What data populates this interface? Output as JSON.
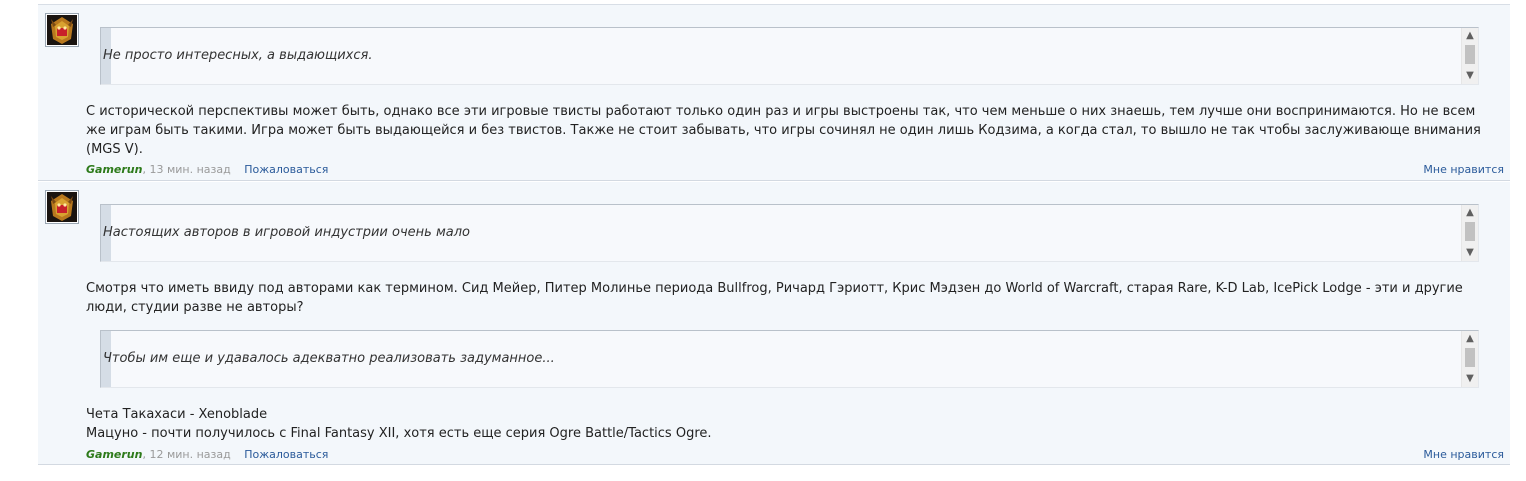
{
  "comments": [
    {
      "quotes": [
        "Не просто интересных, а выдающихся."
      ],
      "paragraphs": [
        "С исторической перспективы может быть, однако все эти игровые твисты работают только один раз и игры выстроены так, что чем меньше о них знаешь, тем лучше они воспринимаются. Но не всем же играм быть такими. Игра может быть выдающейся и без твистов. Также не стоит забывать, что игры сочинял не один лишь Кодзима, а когда стал, то вышло не так чтобы заслуживающе внимания (MGS V)."
      ],
      "author": "Gamerun",
      "time": ", 13 мин. назад",
      "report_label": "Пожаловаться",
      "like_label": "Мне нравится"
    },
    {
      "quotes": [
        "Настоящих авторов в игровой индустрии очень мало",
        "Чтобы им еще и удавалось адекватно реализовать задуманное..."
      ],
      "paragraphs": [
        "Смотря что иметь ввиду под авторами как термином. Сид Мейер, Питер Молинье периода Bullfrog, Ричард Гэриотт, Крис Мэдзен до World of Warcraft, старая Rare, K-D Lab, IcePick Lodge - эти и другие люди, студии разве не авторы?",
        "Чета Такахаси - Xenoblade",
        "Мацуно - почти получилось с Final Fantasy XII, хотя есть еще серия Ogre Battle/Tactics Ogre."
      ],
      "author": "Gamerun",
      "time": ", 12 мин. назад",
      "report_label": "Пожаловаться",
      "like_label": "Мне нравится"
    }
  ],
  "icons": {
    "avatar": "avatar-icon",
    "scroll_up": "chevron-up-icon",
    "scroll_down": "chevron-down-icon"
  },
  "colors": {
    "author": "#2d7a1a",
    "link": "#2a5a9a",
    "comment_bg": "#f3f7fb"
  }
}
